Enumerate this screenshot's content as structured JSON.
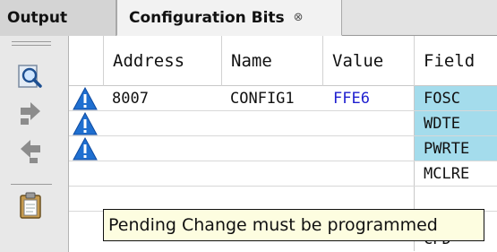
{
  "tabs": [
    {
      "label": "Output"
    },
    {
      "label": "Configuration Bits",
      "close_glyph": "⊗"
    }
  ],
  "toolbar": {
    "icons": [
      "magnifier-icon",
      "arrow-right-icon",
      "arrow-left-icon",
      "clipboard-icon"
    ]
  },
  "table": {
    "columns": [
      "Address",
      "Name",
      "Value",
      "Field"
    ],
    "rows": [
      {
        "warning": true,
        "address": "8007",
        "name": "CONFIG1",
        "value": "FFE6",
        "field": "FOSC",
        "highlighted": true
      },
      {
        "warning": true,
        "address": "",
        "name": "",
        "value": "",
        "field": "WDTE",
        "highlighted": true
      },
      {
        "warning": true,
        "address": "",
        "name": "",
        "value": "",
        "field": "PWRTE",
        "highlighted": true
      },
      {
        "warning": false,
        "address": "",
        "name": "",
        "value": "",
        "field": "MCLRE",
        "highlighted": false
      },
      {
        "warning": false,
        "address": "",
        "name": "",
        "value": "",
        "field": "",
        "highlighted": false
      },
      {
        "warning": false,
        "address": "",
        "name": "",
        "value": "",
        "field": "CPD",
        "highlighted": false
      }
    ]
  },
  "tooltip": {
    "text": "Pending Change must be programmed"
  },
  "colors": {
    "field_highlight": "#a4dcec",
    "value_text": "#1e1ecf",
    "warning": "#1f6fd0"
  }
}
